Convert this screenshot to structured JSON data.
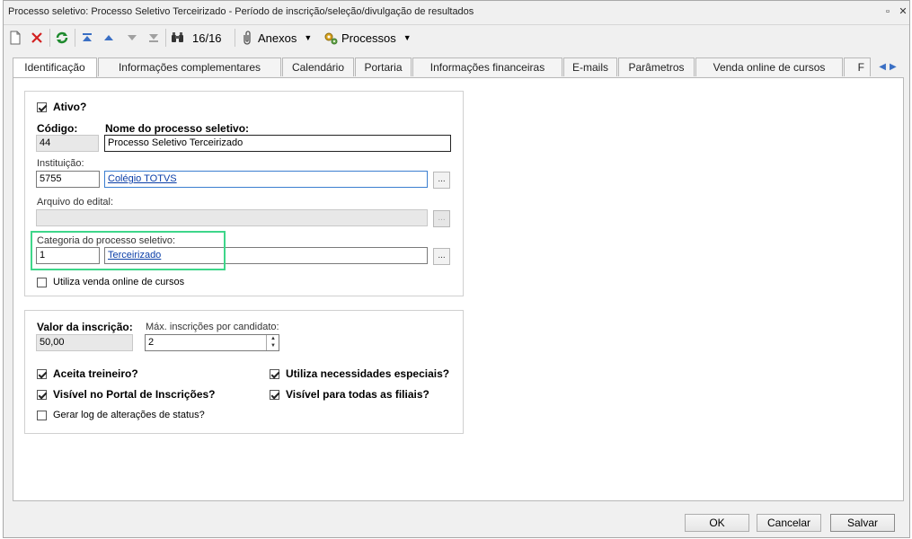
{
  "window": {
    "title": "Processo seletivo: Processo Seletivo Terceirizado - Período de inscrição/seleção/divulgação de resultados",
    "restore_glyph": "▫",
    "close_glyph": "✕"
  },
  "toolbar": {
    "record_counter": "16/16",
    "anexos_label": "Anexos",
    "processos_label": "Processos",
    "icons": [
      "new-icon",
      "delete-icon",
      "refresh-icon",
      "first-icon",
      "previous-icon",
      "next-icon",
      "last-icon",
      "binoculars-icon",
      "paperclip-icon",
      "gear-icon"
    ]
  },
  "tabs": [
    {
      "label": "Identificação"
    },
    {
      "label": "Informações complementares"
    },
    {
      "label": "Calendário"
    },
    {
      "label": "Portaria"
    },
    {
      "label": "Informações financeiras"
    },
    {
      "label": "E-mails"
    },
    {
      "label": "Parâmetros"
    },
    {
      "label": "Venda online de cursos"
    },
    {
      "label": "F"
    }
  ],
  "identification": {
    "ativo_label": "Ativo?",
    "codigo_label": "Código:",
    "codigo_value": "44",
    "nome_label": "Nome do processo seletivo:",
    "nome_value": "Processo Seletivo Terceirizado",
    "instituicao_label": "Instituição:",
    "instituicao_code": "5755",
    "instituicao_name": "Colégio TOTVS",
    "arquivo_label": "Arquivo do edital:",
    "categoria_label": "Categoria do processo seletivo:",
    "categoria_code": "1",
    "categoria_name": "Terceirizado",
    "venda_online_label": "Utiliza venda online de cursos",
    "browse_label": "..."
  },
  "financial": {
    "valor_label": "Valor da inscrição:",
    "valor_value": "50,00",
    "max_label": "Máx. inscrições por candidato:",
    "max_value": "2",
    "aceita_treineiro": "Aceita treineiro?",
    "visivel_portal": "Visível no Portal de Inscrições?",
    "gerar_log": "Gerar log de alterações de status?",
    "necessidades": "Utiliza necessidades especiais?",
    "visivel_filiais": "Visível para todas as filiais?"
  },
  "footer": {
    "ok": "OK",
    "cancel": "Cancelar",
    "save": "Salvar"
  },
  "colors": {
    "highlight": "#3ed68a",
    "link": "#0a3ea8"
  }
}
